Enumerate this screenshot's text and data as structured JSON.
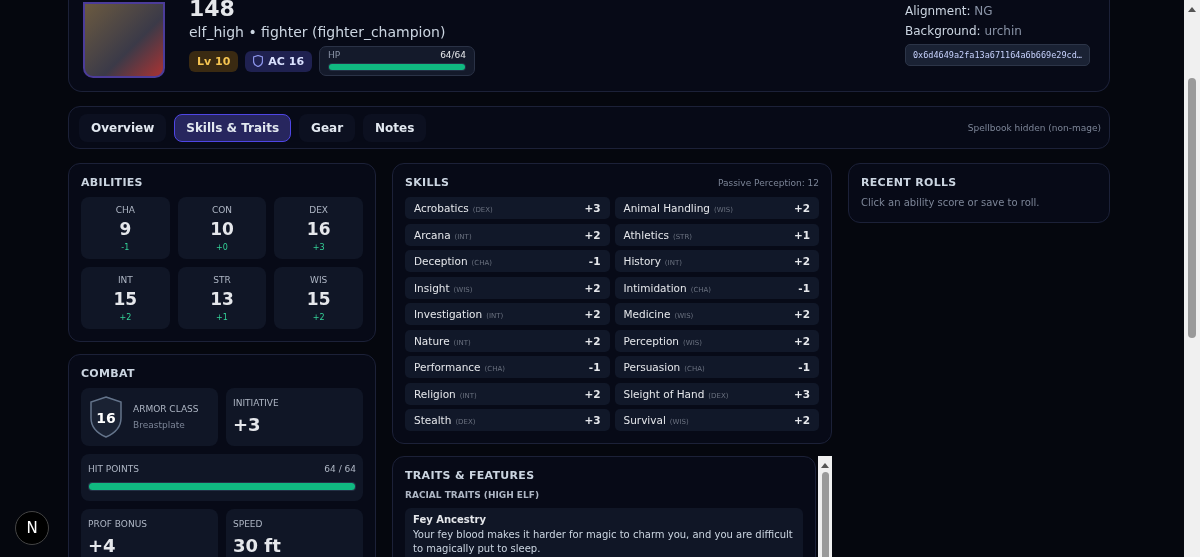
{
  "header": {
    "name": "148",
    "subtitle": "elf_high • fighter (fighter_champion)",
    "level": "Lv 10",
    "ac": "AC 16",
    "hp": {
      "label": "HP",
      "value": "64/64",
      "level": 1
    },
    "alignment": {
      "label": "Alignment:",
      "value": "NG"
    },
    "background": {
      "label": "Background:",
      "value": "urchin"
    },
    "address": "0x6d4649a2fa13a671164a6b669e29cd…"
  },
  "tabs": [
    {
      "label": "Overview",
      "selected": false
    },
    {
      "label": "Skills & Traits",
      "selected": true
    },
    {
      "label": "Gear",
      "selected": false
    },
    {
      "label": "Notes",
      "selected": false
    }
  ],
  "tabs_note": "Spellbook hidden (non-mage)",
  "abilities": {
    "title": "ABILITIES",
    "items": [
      {
        "name": "CHA",
        "score": "9",
        "mod": "-1"
      },
      {
        "name": "CON",
        "score": "10",
        "mod": "+0"
      },
      {
        "name": "DEX",
        "score": "16",
        "mod": "+3"
      },
      {
        "name": "INT",
        "score": "15",
        "mod": "+2"
      },
      {
        "name": "STR",
        "score": "13",
        "mod": "+1"
      },
      {
        "name": "WIS",
        "score": "15",
        "mod": "+2"
      }
    ]
  },
  "combat": {
    "title": "COMBAT",
    "armor": {
      "value": "16",
      "label": "ARMOR CLASS",
      "sub": "Breastplate"
    },
    "initiative": {
      "label": "INITIATIVE",
      "value": "+3"
    },
    "hit_points": {
      "label": "HIT POINTS",
      "value": "64 / 64",
      "level": 1
    },
    "prof": {
      "label": "PROF BONUS",
      "value": "+4"
    },
    "speed": {
      "label": "SPEED",
      "value": "30 ft"
    }
  },
  "skills": {
    "title": "SKILLS",
    "passive": "Passive Perception: 12",
    "items": [
      {
        "name": "Acrobatics",
        "ability": "(DEX)",
        "bonus": "+3"
      },
      {
        "name": "Animal Handling",
        "ability": "(WIS)",
        "bonus": "+2"
      },
      {
        "name": "Arcana",
        "ability": "(INT)",
        "bonus": "+2"
      },
      {
        "name": "Athletics",
        "ability": "(STR)",
        "bonus": "+1"
      },
      {
        "name": "Deception",
        "ability": "(CHA)",
        "bonus": "-1"
      },
      {
        "name": "History",
        "ability": "(INT)",
        "bonus": "+2"
      },
      {
        "name": "Insight",
        "ability": "(WIS)",
        "bonus": "+2"
      },
      {
        "name": "Intimidation",
        "ability": "(CHA)",
        "bonus": "-1"
      },
      {
        "name": "Investigation",
        "ability": "(INT)",
        "bonus": "+2"
      },
      {
        "name": "Medicine",
        "ability": "(WIS)",
        "bonus": "+2"
      },
      {
        "name": "Nature",
        "ability": "(INT)",
        "bonus": "+2"
      },
      {
        "name": "Perception",
        "ability": "(WIS)",
        "bonus": "+2"
      },
      {
        "name": "Performance",
        "ability": "(CHA)",
        "bonus": "-1"
      },
      {
        "name": "Persuasion",
        "ability": "(CHA)",
        "bonus": "-1"
      },
      {
        "name": "Religion",
        "ability": "(INT)",
        "bonus": "+2"
      },
      {
        "name": "Sleight of Hand",
        "ability": "(DEX)",
        "bonus": "+3"
      },
      {
        "name": "Stealth",
        "ability": "(DEX)",
        "bonus": "+3"
      },
      {
        "name": "Survival",
        "ability": "(WIS)",
        "bonus": "+2"
      }
    ]
  },
  "traits": {
    "title": "TRAITS & FEATURES",
    "section": "RACIAL TRAITS (HIGH ELF)",
    "items": [
      {
        "name": "Fey Ancestry",
        "text": "Your fey blood makes it harder for magic to charm you, and you are difficult to magically put to sleep."
      }
    ]
  },
  "recent_rolls": {
    "title": "RECENT ROLLS",
    "hint": "Click an ability score or save to roll."
  },
  "dev_indicator": "N"
}
